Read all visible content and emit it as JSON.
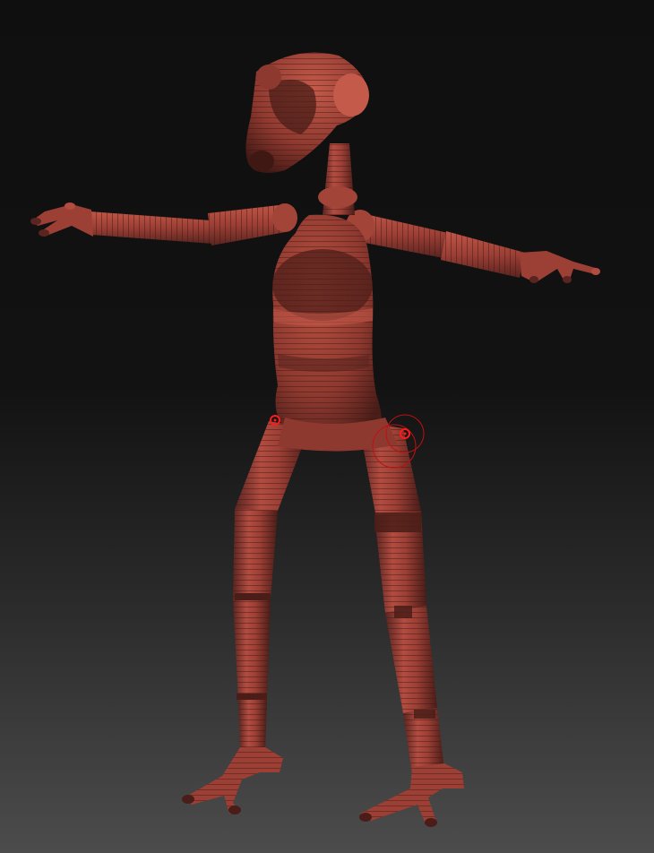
{
  "viewport": {
    "background": "gradient",
    "background_colors": [
      "#0f0f0f",
      "#4c4c4c"
    ]
  },
  "model": {
    "name": "segmented-humanoid-mannequin",
    "material_colors": {
      "base": "#9c3f35",
      "highlight": "#c9604f",
      "shadow": "#4a1d18",
      "dark_band": "#5a2520"
    },
    "pose": "arms-outstretched-standing"
  },
  "gizmo": {
    "color": "#ff1a1a",
    "markers": [
      "pivot-marker-left-hip",
      "pivot-marker-right-hip"
    ]
  }
}
